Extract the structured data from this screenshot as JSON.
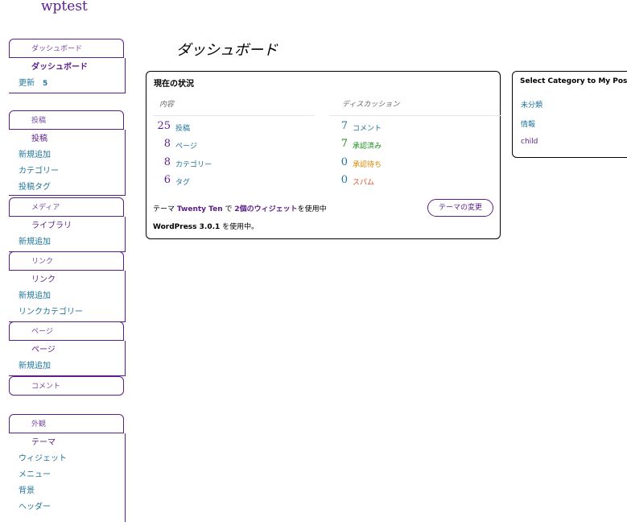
{
  "site": {
    "title": "wptest"
  },
  "page": {
    "title": "ダッシュボード"
  },
  "menu": {
    "dashboard": {
      "head": "ダッシュボード",
      "items": [
        "ダッシュボード"
      ],
      "update_label": "更新",
      "update_count": "5"
    },
    "posts": {
      "head": "投稿",
      "items": [
        "投稿",
        "新規追加",
        "カテゴリー",
        "投稿タグ"
      ]
    },
    "media": {
      "head": "メディア",
      "items": [
        "ライブラリ",
        "新規追加"
      ]
    },
    "links": {
      "head": "リンク",
      "items": [
        "リンク",
        "新規追加",
        "リンクカテゴリー"
      ]
    },
    "pages": {
      "head": "ページ",
      "items": [
        "ページ",
        "新規追加"
      ]
    },
    "comments": {
      "head": "コメント"
    },
    "appearance": {
      "head": "外観",
      "items": [
        "テーマ",
        "ウィジェット",
        "メニュー",
        "背景",
        "ヘッダー"
      ]
    }
  },
  "right_now": {
    "title": "現在の状況",
    "content_head": "内容",
    "discussion_head": "ディスカッション",
    "content": [
      {
        "num": "25",
        "label": "投稿"
      },
      {
        "num": "8",
        "label": "ページ"
      },
      {
        "num": "8",
        "label": "カテゴリー"
      },
      {
        "num": "6",
        "label": "タグ"
      }
    ],
    "discussion": [
      {
        "num": "7",
        "label": "コメント"
      },
      {
        "num": "7",
        "label": "承認済み"
      },
      {
        "num": "0",
        "label": "承認待ち"
      },
      {
        "num": "0",
        "label": "スパム"
      }
    ],
    "theme_prefix": "テーマ",
    "theme_name": "Twenty Ten",
    "theme_mid": "で",
    "widgets": "2個のウィジェット",
    "theme_suffix": "を使用中",
    "change_theme": "テーマの変更",
    "wp_version": "WordPress 3.0.1",
    "wp_suffix": "を使用中。"
  },
  "category_widget": {
    "title": "Select Category to My Post",
    "items": [
      "未分類",
      "情報",
      "child"
    ]
  },
  "colors": {
    "accent": "#5a1e8a",
    "link": "#21759b",
    "approved": "#1a8a1a",
    "pending": "#d98500",
    "spam": "#d54e21"
  }
}
